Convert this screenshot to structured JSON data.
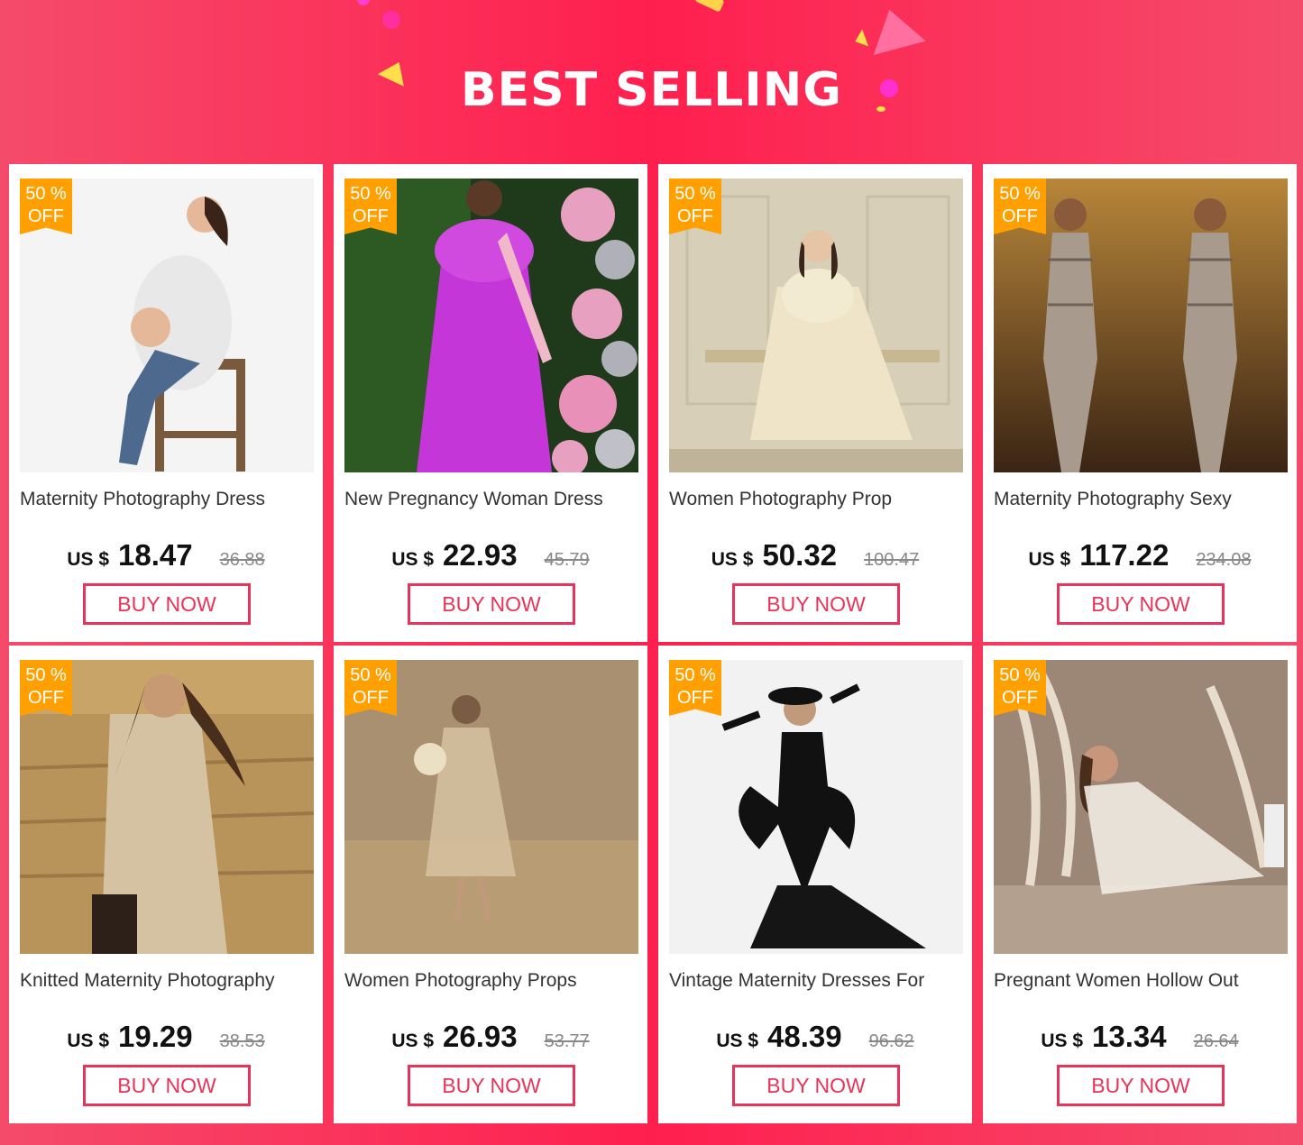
{
  "banner": {
    "title": "BEST SELLING"
  },
  "colors": {
    "accent": "#e8345a",
    "badge": "#ffa000",
    "banner": "#ff1f4f"
  },
  "products": [
    {
      "title": "Maternity Photography Dress",
      "currency": "US $",
      "price": "18.47",
      "old_price": "36.88",
      "badge_pct": "50 %",
      "badge_off": "OFF",
      "button": "BUY NOW"
    },
    {
      "title": "New Pregnancy Woman Dress",
      "currency": "US $",
      "price": "22.93",
      "old_price": "45.79",
      "badge_pct": "50 %",
      "badge_off": "OFF",
      "button": "BUY NOW"
    },
    {
      "title": "Women Photography Prop",
      "currency": "US $",
      "price": "50.32",
      "old_price": "100.47",
      "badge_pct": "50 %",
      "badge_off": "OFF",
      "button": "BUY NOW"
    },
    {
      "title": "Maternity Photography Sexy",
      "currency": "US $",
      "price": "117.22",
      "old_price": "234.08",
      "badge_pct": "50 %",
      "badge_off": "OFF",
      "button": "BUY NOW"
    },
    {
      "title": "Knitted Maternity Photography",
      "currency": "US $",
      "price": "19.29",
      "old_price": "38.53",
      "badge_pct": "50 %",
      "badge_off": "OFF",
      "button": "BUY NOW"
    },
    {
      "title": "Women Photography Props",
      "currency": "US $",
      "price": "26.93",
      "old_price": "53.77",
      "badge_pct": "50 %",
      "badge_off": "OFF",
      "button": "BUY NOW"
    },
    {
      "title": "Vintage Maternity Dresses For",
      "currency": "US $",
      "price": "48.39",
      "old_price": "96.62",
      "badge_pct": "50 %",
      "badge_off": "OFF",
      "button": "BUY NOW"
    },
    {
      "title": "Pregnant Women Hollow Out",
      "currency": "US $",
      "price": "13.34",
      "old_price": "26.64",
      "badge_pct": "50 %",
      "badge_off": "OFF",
      "button": "BUY NOW"
    }
  ]
}
